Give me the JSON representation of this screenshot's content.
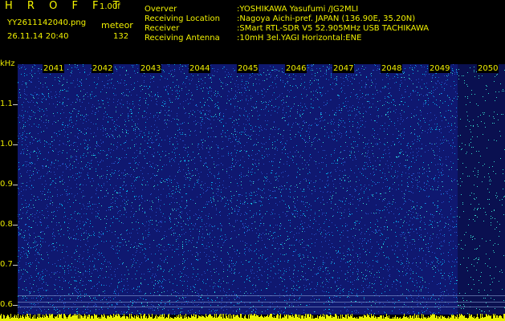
{
  "header": {
    "brand": "H R O F F T",
    "version": "1.00f",
    "filename": "YY2611142040.png",
    "mode": "meteor",
    "datetime": "26.11.14 20:40",
    "count": "132"
  },
  "info": [
    {
      "label": "Overver",
      "value": ":YOSHIKAWA Yasufumi /JG2MLI"
    },
    {
      "label": "Receiving Location",
      "value": ":Nagoya Aichi-pref. JAPAN (136.90E, 35.20N)"
    },
    {
      "label": "Receiver",
      "value": ":SMart RTL-SDR V5 52.905MHz USB TACHIKAWA"
    },
    {
      "label": "Receiving Antenna",
      "value": ":10mH 3el.YAGI Horizontal:ENE"
    }
  ],
  "axis": {
    "unit": "kHz",
    "ticks": [
      "1.1",
      "1.0",
      "0.9",
      "0.8",
      "0.7",
      "0.6"
    ]
  },
  "minutes": [
    "2041",
    "2042",
    "2043",
    "2044",
    "2045",
    "2046",
    "2047",
    "2048",
    "2049",
    "2050"
  ],
  "colors": {
    "background": "#000000",
    "text": "#f2f200",
    "spectrum_base": "#0f1870",
    "noise_bright": "#00c8ff",
    "noise_cyan": "#40ffe0",
    "bar_yellow": "#e8f000"
  }
}
